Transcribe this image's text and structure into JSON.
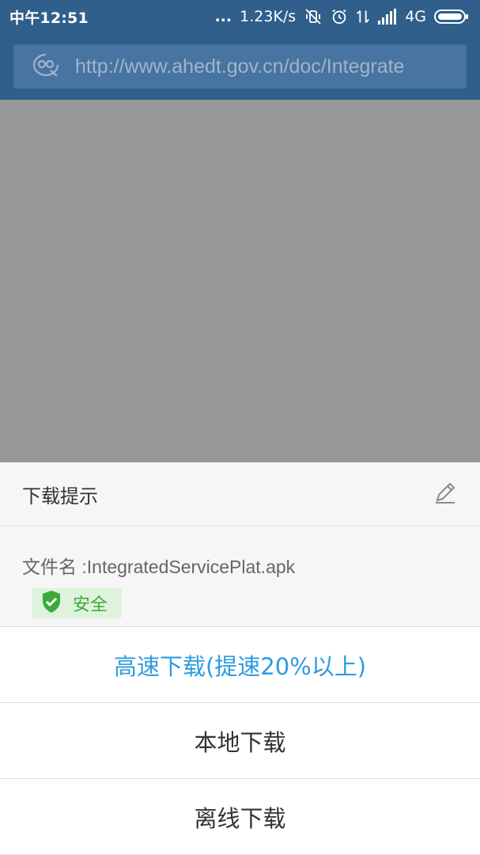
{
  "status_bar": {
    "time": "中午12:51",
    "dots": "...",
    "network_speed": "1.23K/s",
    "network_type": "4G"
  },
  "url_bar": {
    "url": "http://www.ahedt.gov.cn/doc/Integrate"
  },
  "dialog": {
    "title": "下载提示",
    "file_label": "文件名 :IntegratedServicePlat.apk",
    "safety_badge": "安全",
    "options": [
      "高速下载(提速20%以上)",
      "本地下载",
      "离线下载"
    ]
  },
  "colors": {
    "status_bar_bg": "#2f5f8a",
    "primary_option": "#2d9be0",
    "safe_green": "#3aab3a",
    "overlay_grey": "#979797"
  }
}
